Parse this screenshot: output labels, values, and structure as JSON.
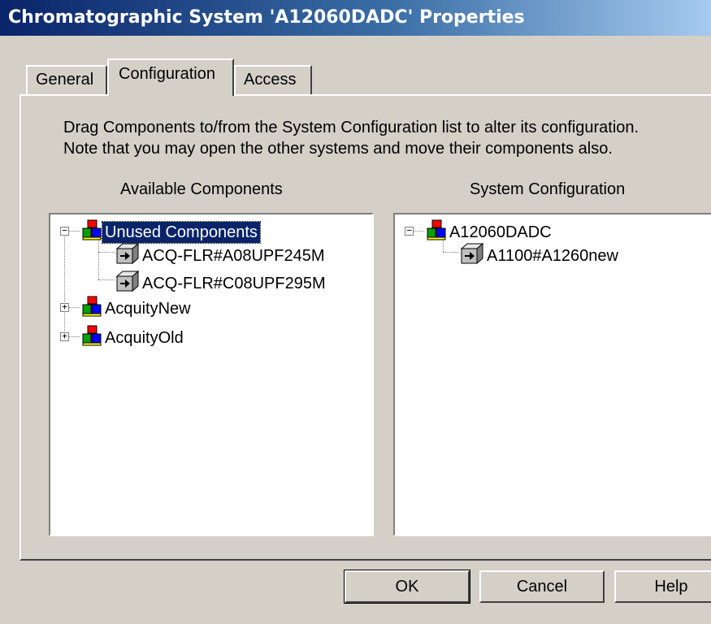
{
  "window": {
    "title": "Chromatographic System 'A12060DADC' Properties"
  },
  "tabs": [
    {
      "label": "General"
    },
    {
      "label": "Configuration"
    },
    {
      "label": "Access"
    }
  ],
  "instructions": {
    "line1": "Drag Components to/from the System Configuration list to alter its configuration.",
    "line2": "Note that you may open the other systems and move their components also."
  },
  "available": {
    "heading": "Available Components",
    "groups": [
      {
        "label": "Unused Components",
        "expanded": true,
        "selected": true,
        "children": [
          {
            "label": "ACQ-FLR#A08UPF245M"
          },
          {
            "label": "ACQ-FLR#C08UPF295M"
          }
        ]
      },
      {
        "label": "AcquityNew",
        "expanded": false
      },
      {
        "label": "AcquityOld",
        "expanded": false
      }
    ]
  },
  "system": {
    "heading": "System Configuration",
    "root": {
      "label": "A12060DADC",
      "expanded": true,
      "children": [
        {
          "label": "A1100#A1260new"
        }
      ]
    }
  },
  "buttons": {
    "ok": "OK",
    "cancel": "Cancel",
    "help": "Help"
  },
  "icons": {
    "system": "system-blocks-icon",
    "component": "component-cube-icon",
    "expanded": "minus-box",
    "collapsed": "plus-box"
  },
  "colors": {
    "title_start": "#0a246a",
    "title_end": "#a6caf0",
    "selection": "#0a246a",
    "face": "#d4d0c8"
  }
}
